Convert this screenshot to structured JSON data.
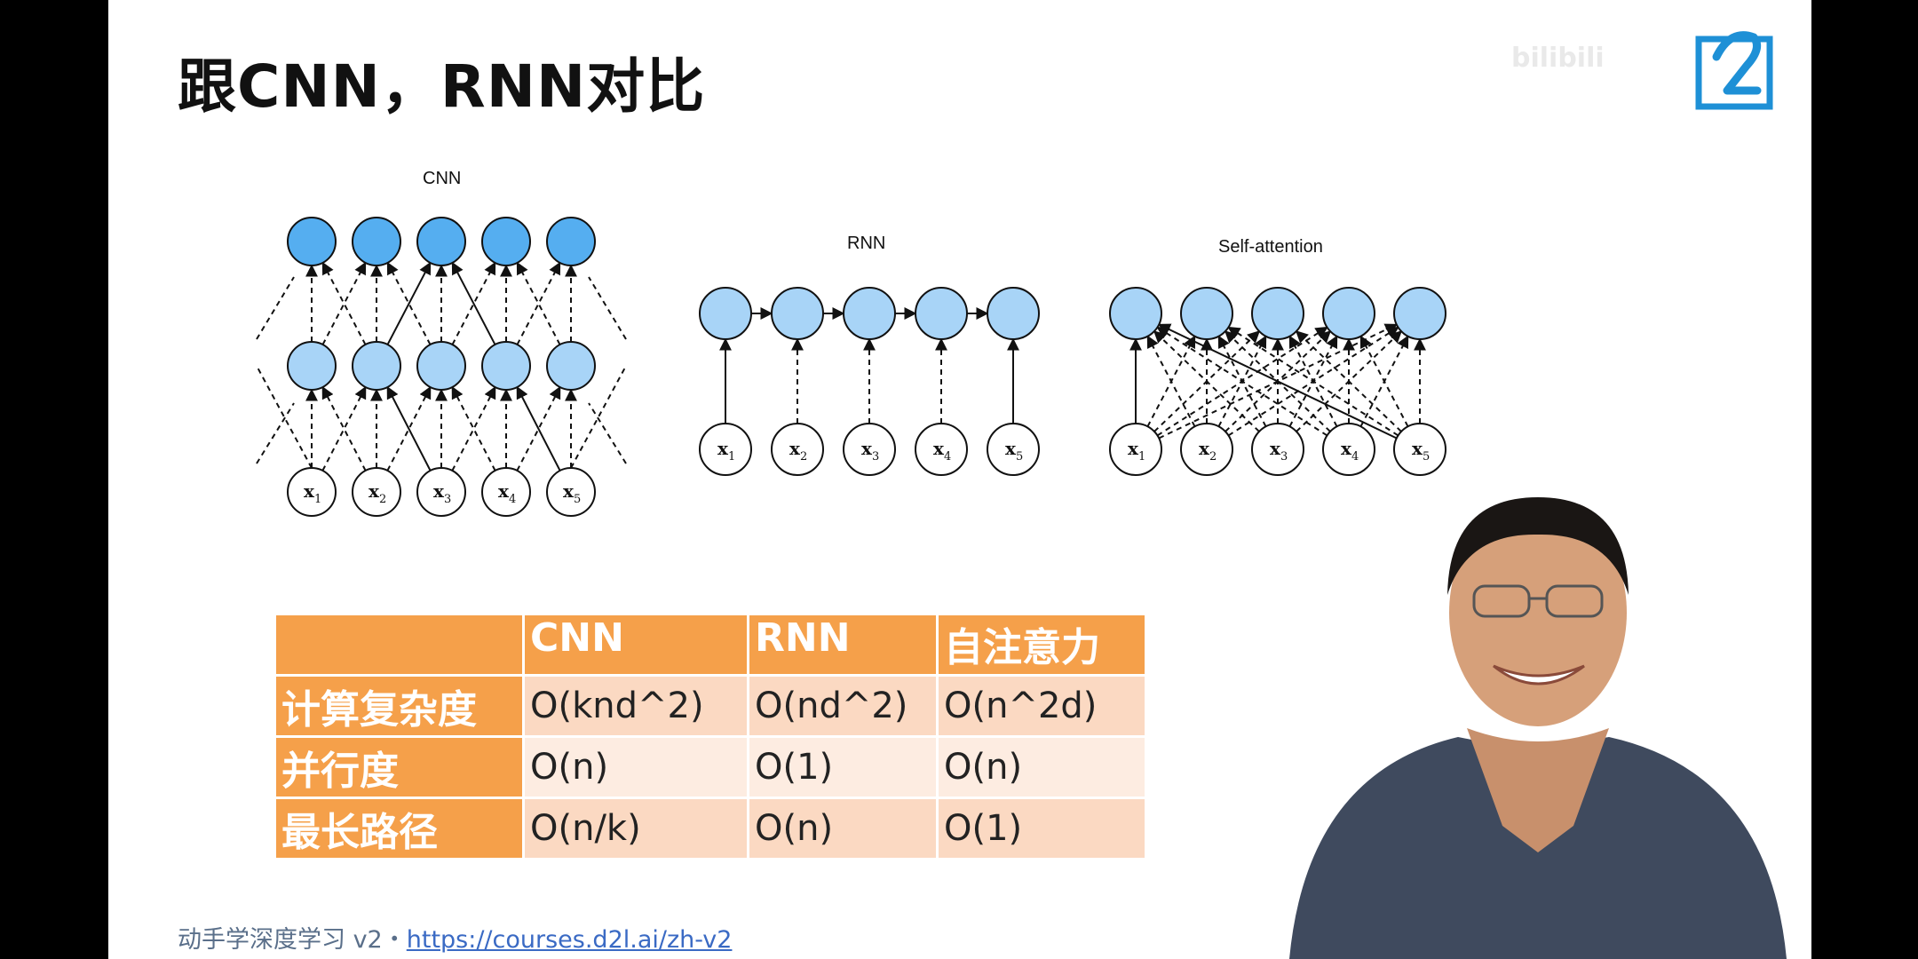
{
  "slide": {
    "title": "跟CNN，RNN对比",
    "watermark": "bilibili",
    "footer": {
      "text": "动手学深度学习 v2・",
      "link": "https://courses.d2l.ai/zh-v2"
    }
  },
  "diagrams": {
    "cnn_label": "CNN",
    "rnn_label": "RNN",
    "self_attention_label": "Self-attention",
    "input_labels": [
      "x1",
      "x2",
      "x3",
      "x4",
      "x5"
    ]
  },
  "table": {
    "header": [
      "",
      "CNN",
      "RNN",
      "自注意力"
    ],
    "rows": [
      {
        "label": "计算复杂度",
        "values": [
          "O(knd^2)",
          "O(nd^2)",
          "O(n^2d)"
        ]
      },
      {
        "label": "并行度",
        "values": [
          "O(n)",
          "O(1)",
          "O(n)"
        ]
      },
      {
        "label": "最长路径",
        "values": [
          "O(n/k)",
          "O(n)",
          "O(1)"
        ]
      }
    ]
  },
  "colors": {
    "node_dark": "#55aef0",
    "node_light": "#a8d4f7",
    "table_header": "#f5a04a"
  }
}
